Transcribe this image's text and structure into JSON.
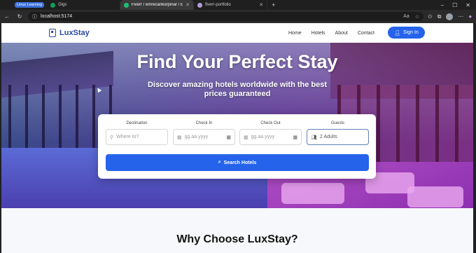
{
  "browser": {
    "tab_group_label": "Linux Learning",
    "tabs": [
      {
        "label": "Gigs",
        "favicon_color": "#0f9d58"
      },
      {
        "label": "Fiverr / emrecankorpinar / Edit Gi...",
        "favicon_color": "#1dbf73"
      },
      {
        "label": "fiverr-portfolio",
        "favicon_color": "#b39ddb"
      }
    ],
    "url": "localhost:5174"
  },
  "site": {
    "brand": "LuxStay",
    "nav": [
      "Home",
      "Hotels",
      "About",
      "Contact"
    ],
    "signin_label": "Sign In"
  },
  "hero": {
    "title": "Find Your Perfect Stay",
    "subtitle": "Discover amazing hotels worldwide with the best prices guaranteed"
  },
  "search": {
    "destination_label": "Destination",
    "destination_placeholder": "Where to?",
    "checkin_label": "Check In",
    "checkin_placeholder": "gg.aa.yyyy",
    "checkout_label": "Check Out",
    "checkout_placeholder": "gg.aa.yyyy",
    "guests_label": "Guests",
    "guests_value": "2 Adults",
    "button_label": "Search Hotels"
  },
  "section": {
    "heading": "Why Choose LuxStay?"
  },
  "colors": {
    "primary": "#2563eb",
    "brand": "#2b4a9e"
  }
}
